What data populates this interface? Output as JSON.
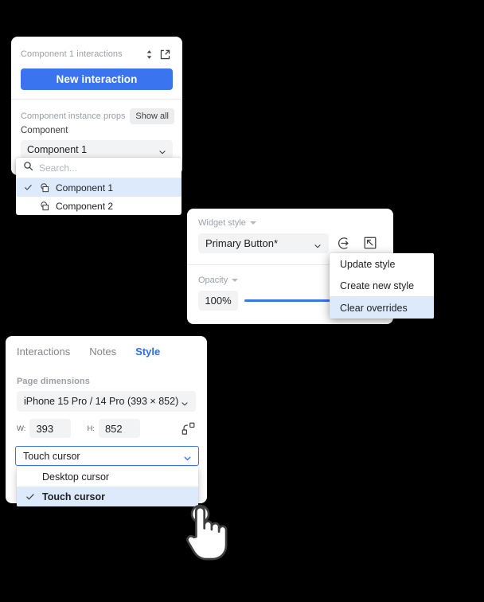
{
  "colors": {
    "accent": "#3b74ef",
    "tab_active": "#2b6cf5",
    "selection_bg": "#dceafb",
    "field_bg": "#f1f3f4",
    "muted_text": "#9aa0a6",
    "text": "#202124",
    "canvas": "#000000"
  },
  "interactions_panel": {
    "title": "Component 1 interactions",
    "collapse_icon": "chevron-up-down-icon",
    "expand_icon": "external-link-icon",
    "new_interaction_label": "New interaction",
    "props_label": "Component instance props",
    "show_all_label": "Show all",
    "component_field_label": "Component",
    "component_value": "Component 1",
    "caret_icon": "chevron-down-icon"
  },
  "component_dropdown": {
    "search_icon": "search-icon",
    "search_value": "",
    "search_placeholder": "Search...",
    "items": [
      {
        "label": "Component 1",
        "selected": true,
        "icon": "component-icon",
        "check_icon": "check-icon"
      },
      {
        "label": "Component 2",
        "selected": false,
        "icon": "component-icon",
        "check_icon": "check-icon"
      }
    ]
  },
  "widget_panel": {
    "style_label": "Widget style",
    "style_label_caret": "triangle-down-icon",
    "style_value": "Primary Button*",
    "caret_icon": "chevron-down-icon",
    "goto_style_icon": "arrow-into-circle-icon",
    "style_options_icon": "arrow-to-corner-box-icon",
    "opacity_label": "Opacity",
    "opacity_label_caret": "triangle-down-icon",
    "opacity_value": "100%",
    "opacity_percent": 100
  },
  "style_menu": {
    "items": [
      {
        "label": "Update style",
        "selected": false,
        "separator_before": false
      },
      {
        "label": "Create new style",
        "selected": false,
        "separator_before": false
      },
      {
        "label": "Clear overrides",
        "selected": true,
        "separator_before": true
      }
    ]
  },
  "style_panel": {
    "tabs": [
      {
        "label": "Interactions",
        "active": false
      },
      {
        "label": "Notes",
        "active": false
      },
      {
        "label": "Style",
        "active": true
      }
    ],
    "page_dimensions_label": "Page dimensions",
    "preset_value": "iPhone 15 Pro / 14 Pro  (393 × 852)",
    "caret_icon": "chevron-down-icon",
    "width_tag": "W:",
    "width_value": "393",
    "height_tag": "H:",
    "height_value": "852",
    "aspect_link_icon": "aspect-ratio-unlink-icon",
    "cursor_value": "Touch cursor",
    "cursor_caret_icon": "chevron-down-icon",
    "cursor_options": [
      {
        "label": "Desktop cursor",
        "selected": false
      },
      {
        "label": "Touch cursor",
        "selected": true,
        "check_icon": "check-icon"
      }
    ]
  },
  "overlay": {
    "touch_cursor_icon": "touch-hand-cursor-icon"
  }
}
